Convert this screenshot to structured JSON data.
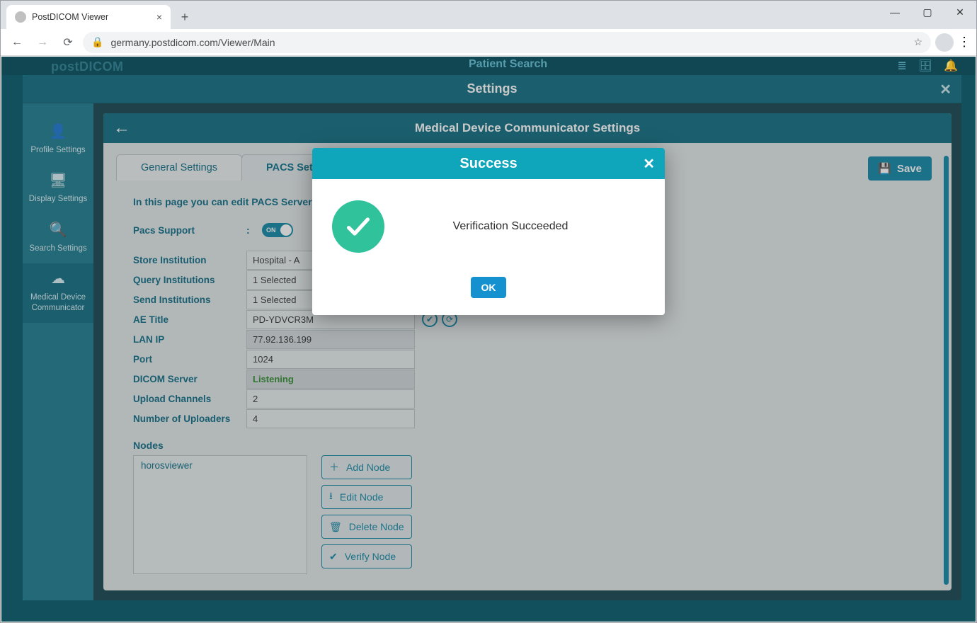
{
  "browser": {
    "tab_title": "PostDICOM Viewer",
    "url": "germany.postdicom.com/Viewer/Main"
  },
  "bg": {
    "logo": "postDICOM",
    "title": "Patient Search"
  },
  "settings": {
    "title": "Settings",
    "sidenav": [
      {
        "icon": "👤",
        "label": "Profile Settings"
      },
      {
        "icon": "🖥",
        "label": "Display Settings"
      },
      {
        "icon": "🔍",
        "label": "Search Settings"
      },
      {
        "icon": "☁",
        "label": "Medical Device Communicator"
      }
    ],
    "panel_title": "Medical Device Communicator Settings",
    "tabs": {
      "general": "General Settings",
      "pacs": "PACS Settings"
    },
    "save_label": "Save",
    "desc": "In this page you can edit PACS Server settings.",
    "pacs_support_label": "Pacs Support",
    "pacs_support_toggle": "ON",
    "fields": {
      "store_institution": {
        "label": "Store Institution",
        "value": "Hospital - A"
      },
      "query_institutions": {
        "label": "Query Institutions",
        "value": "1 Selected"
      },
      "send_institutions": {
        "label": "Send Institutions",
        "value": "1 Selected"
      },
      "ae_title": {
        "label": "AE Title",
        "value": "PD-YDVCR3M"
      },
      "lan_ip": {
        "label": "LAN IP",
        "value": "77.92.136.199"
      },
      "port": {
        "label": "Port",
        "value": "1024"
      },
      "dicom_server": {
        "label": "DICOM Server",
        "value": "Listening"
      },
      "upload_channels": {
        "label": "Upload Channels",
        "value": "2"
      },
      "num_uploaders": {
        "label": "Number of Uploaders",
        "value": "4"
      }
    },
    "nodes_label": "Nodes",
    "nodes": [
      "horosviewer"
    ],
    "node_buttons": {
      "add": "Add Node",
      "edit": "Edit Node",
      "delete": "Delete Node",
      "verify": "Verify Node"
    }
  },
  "dialog": {
    "title": "Success",
    "message": "Verification Succeeded",
    "ok": "OK"
  }
}
